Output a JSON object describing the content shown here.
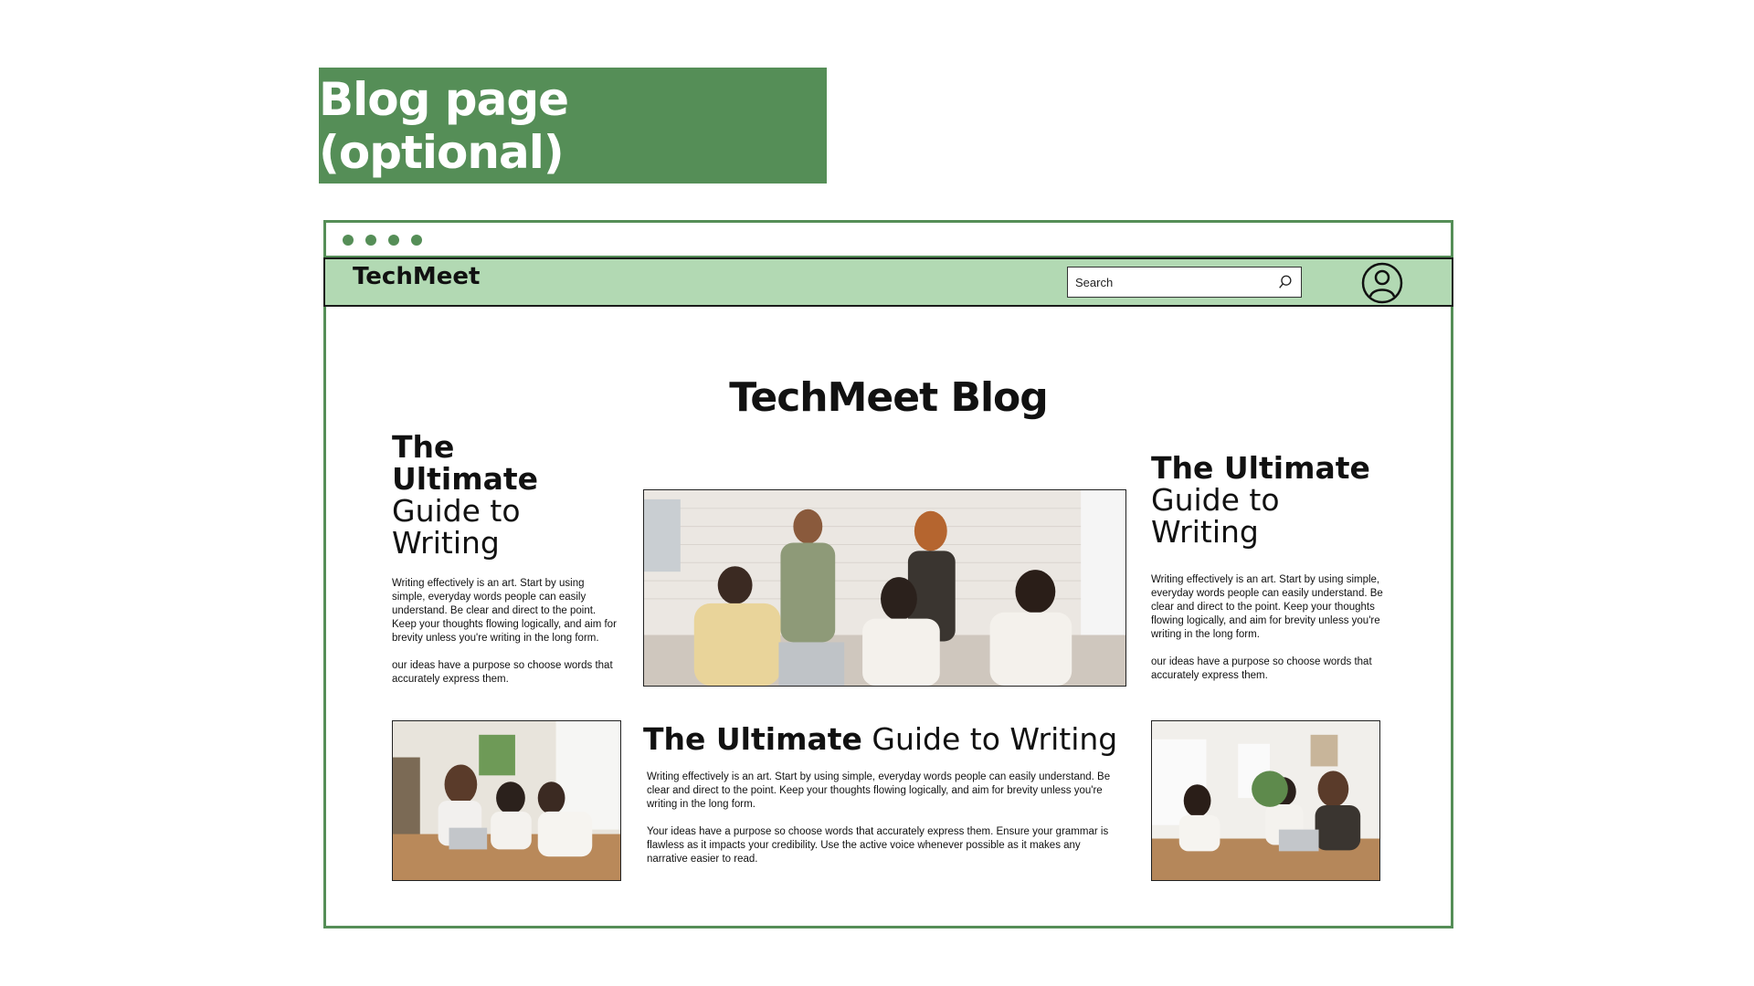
{
  "slide": {
    "title": "Blog page (optional)"
  },
  "navbar": {
    "brand": "TechMeet",
    "search_placeholder": "Search"
  },
  "page": {
    "heading": "TechMeet Blog"
  },
  "posts": {
    "left": {
      "title_bold": "The Ultimate",
      "title_light": "Guide to Writing",
      "paragraphs": [
        "Writing effectively is an art. Start by using simple, everyday words people can easily understand. Be clear and direct to the point. Keep your thoughts flowing logically, and aim for brevity unless you're writing in the long form.",
        "our ideas have a purpose so choose words that accurately express them."
      ]
    },
    "right": {
      "title_bold": "The Ultimate",
      "title_light": "Guide to Writing",
      "paragraphs": [
        "Writing effectively is an art. Start by using simple, everyday words people can easily understand. Be clear and direct to the point. Keep your thoughts flowing logically, and aim for brevity unless you're writing in the long form.",
        "our ideas have a purpose so choose words that accurately express them."
      ]
    },
    "center": {
      "title_bold": "The Ultimate",
      "title_light": "Guide to Writing",
      "paragraphs": [
        "Writing effectively is an art. Start by using simple, everyday words people can easily understand. Be clear and direct to the point. Keep your thoughts flowing logically, and aim for brevity unless you're writing in the long form.",
        "Your ideas have a purpose so choose words that accurately express them. Ensure your grammar is flawless as it impacts your credibility. Use the active voice whenever possible as it makes any narrative easier to read."
      ]
    }
  },
  "colors": {
    "accent": "#558e57",
    "navbar": "#b2d9b3"
  }
}
